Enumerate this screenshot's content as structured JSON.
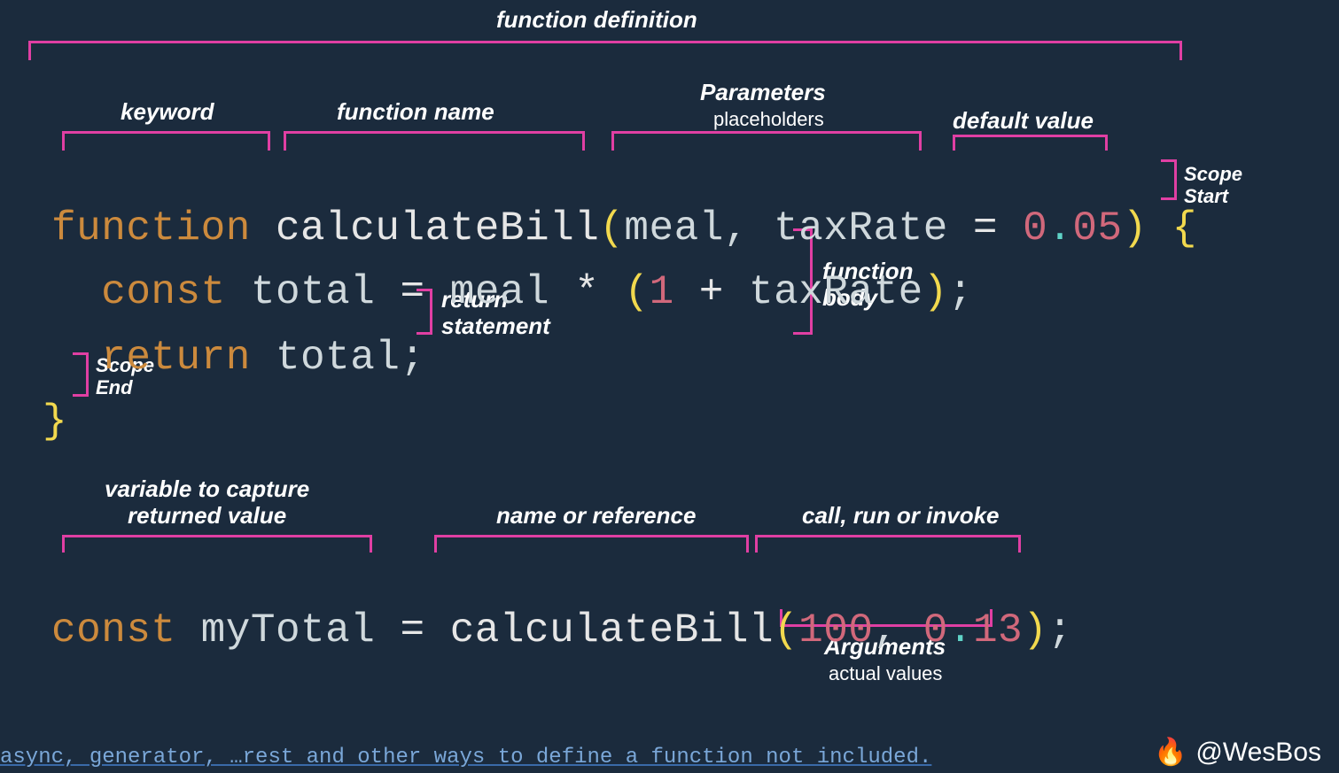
{
  "labels": {
    "functionDefinition": "function definition",
    "keyword": "keyword",
    "functionName": "function name",
    "parameters": "Parameters",
    "parametersSub": "placeholders",
    "defaultValue": "default value",
    "scopeStart": "Scope\nStart",
    "functionBody": "function\nbody",
    "returnStatement": "return\nstatement",
    "scopeEnd": "Scope\nEnd",
    "varCapture": "variable to capture\nreturned value",
    "nameOrRef": "name or reference",
    "callRunInvoke": "call, run or invoke",
    "arguments": "Arguments",
    "argumentsSub": "actual values"
  },
  "code": {
    "line1": {
      "function": "function ",
      "name": "calculateBill",
      "lparen": "(",
      "p1": "meal",
      "comma1": ", ",
      "p2": "taxRate ",
      "eq": "= ",
      "zero": "0",
      "dot": ".",
      "rest": "05",
      "rparen": ") ",
      "brace": "{"
    },
    "line2": {
      "indent": "  ",
      "const": "const ",
      "total": "total ",
      "eq": "= ",
      "meal": "meal ",
      "star": "* ",
      "lparen": "(",
      "one": "1 ",
      "plus": "+ ",
      "taxRate": "taxRate",
      "rparen": ")",
      "semi": ";"
    },
    "line3": {
      "indent": "  ",
      "return": "return ",
      "total": "total",
      "semi": ";"
    },
    "line4": {
      "brace": "}"
    },
    "line5": {
      "const": "const ",
      "myTotal": "myTotal ",
      "eq": "= ",
      "fn": "calculateBill",
      "lparen": "(",
      "a1a": "100",
      "comma": ", ",
      "a2a": "0",
      "dot": ".",
      "a2b": "13",
      "rparen": ")",
      "semi": ";"
    }
  },
  "footnote": "async, generator, …rest and other ways to define a function not included.",
  "credit": "@WesBos",
  "fireIcon": "🔥"
}
